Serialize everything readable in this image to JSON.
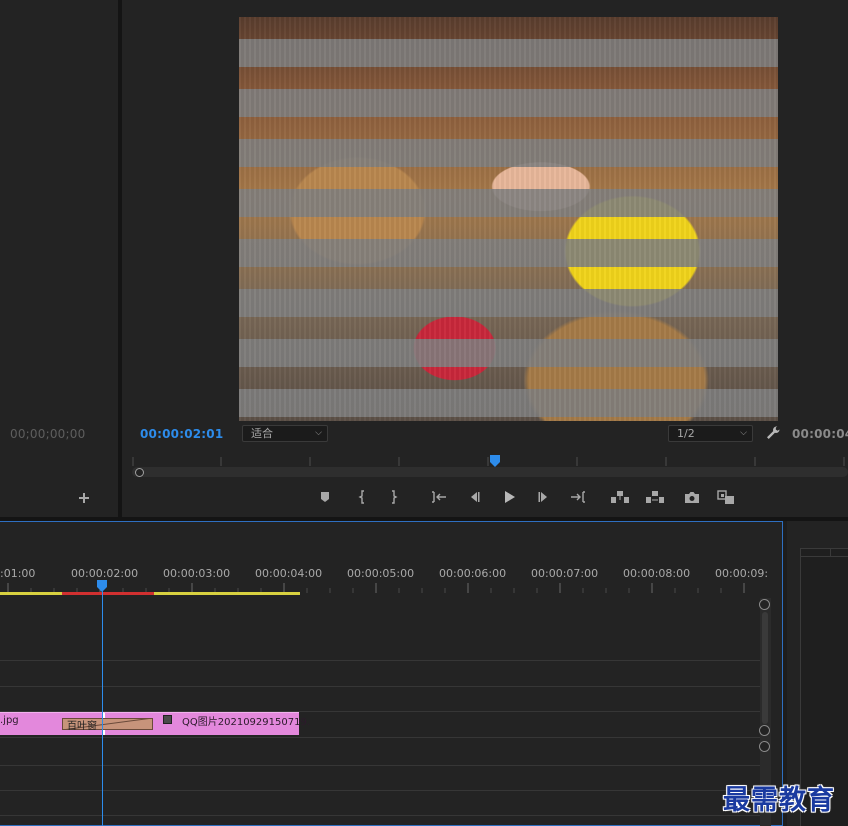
{
  "source_monitor": {
    "timecode": "00;00;00;00"
  },
  "program_monitor": {
    "timecode": "00:00:02:01",
    "duration": "00:00:04",
    "fit_label": "适合",
    "resolution_label": "1/2",
    "playhead_fraction": 0.5
  },
  "timeline": {
    "ruler_labels": [
      ":01:00",
      "00:00:02:00",
      "00:00:03:00",
      "00:00:04:00",
      "00:00:05:00",
      "00:00:06:00",
      "00:00:07:00",
      "00:00:08:00",
      "00:00:09:"
    ],
    "clip_a_label": ".jpg",
    "clip_b_label": "QQ图片20210929150719.",
    "transition_label": "百叶窗"
  },
  "watermark": "最需教育",
  "colors": {
    "accent_blue": "#2d8ceb",
    "clip_pink": "#e388dc",
    "work_area_yellow": "#d8d140",
    "render_red": "#d13030",
    "transition_tan": "#c7947b"
  }
}
